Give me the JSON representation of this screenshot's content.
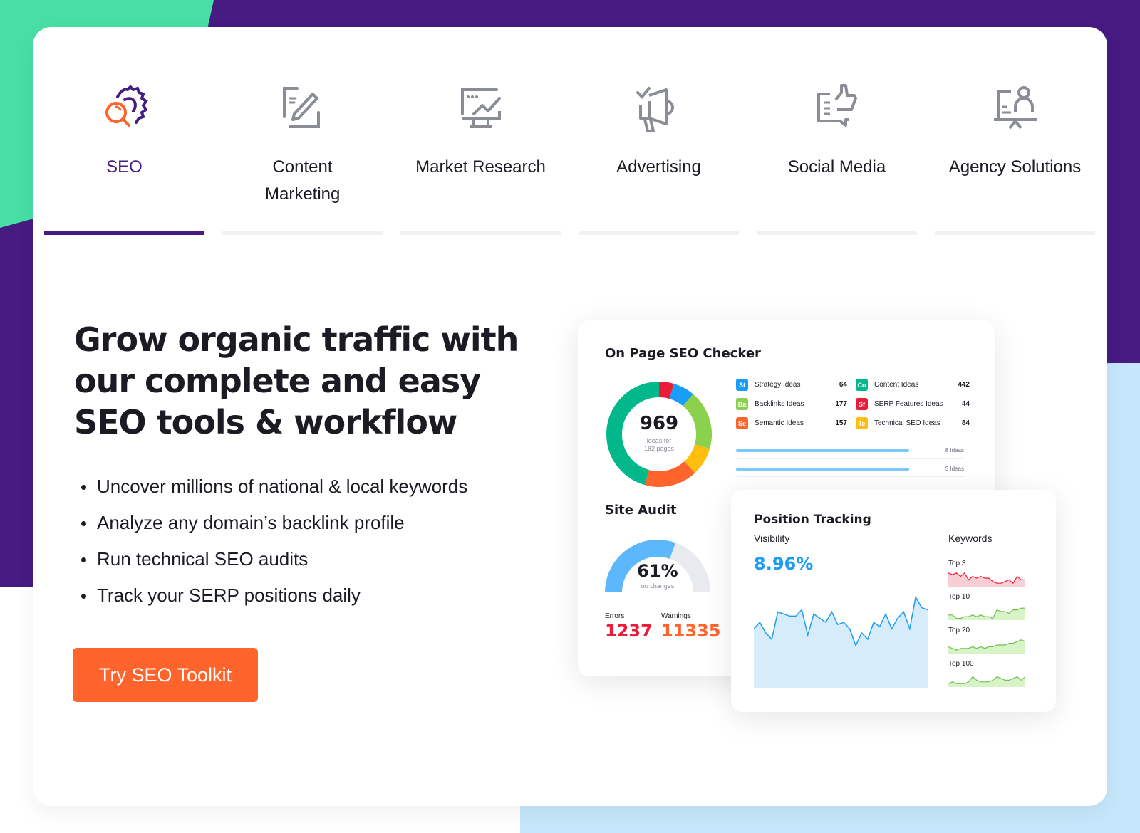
{
  "tabs": [
    {
      "label": "SEO",
      "icon": "seo-gear-search-icon",
      "active": true
    },
    {
      "label": "Content Marketing",
      "icon": "content-edit-icon",
      "active": false
    },
    {
      "label": "Market Research",
      "icon": "market-research-monitor-icon",
      "active": false
    },
    {
      "label": "Advertising",
      "icon": "megaphone-icon",
      "active": false
    },
    {
      "label": "Social Media",
      "icon": "thumbs-up-chat-icon",
      "active": false
    },
    {
      "label": "Agency Solutions",
      "icon": "presentation-person-icon",
      "active": false
    }
  ],
  "hero": {
    "title": "Grow organic traffic with our complete and easy SEO tools & workflow",
    "bullets": [
      "Uncover millions of national & local keywords",
      "Analyze any domain’s backlink profile",
      "Run technical SEO audits",
      "Track your SERP positions daily"
    ],
    "cta_label": "Try SEO Toolkit"
  },
  "colors": {
    "brand_purple": "#461b82",
    "brand_orange": "#ff642d",
    "accent_green": "#47dfa6",
    "accent_blue": "#1a9df5"
  },
  "on_page": {
    "title": "On Page SEO Checker",
    "total": "969",
    "total_sub_line1": "ideas for",
    "total_sub_line2": "182 pages",
    "ideas": [
      {
        "abbr": "St",
        "name": "Strategy Ideas",
        "count": 64,
        "color": "#1a9df5"
      },
      {
        "abbr": "Ba",
        "name": "Backlinks Ideas",
        "count": 177,
        "color": "#8bd14e"
      },
      {
        "abbr": "Se",
        "name": "Semantic Ideas",
        "count": 157,
        "color": "#ff642d"
      },
      {
        "abbr": "Co",
        "name": "Content Ideas",
        "count": 442,
        "color": "#00b88a"
      },
      {
        "abbr": "Sf",
        "name": "SERP Features Ideas",
        "count": 44,
        "color": "#ed1b3a"
      },
      {
        "abbr": "Te",
        "name": "Technical SEO Ideas",
        "count": 84,
        "color": "#ffbe0b"
      }
    ],
    "page_bars": [
      {
        "label": "8 Ideas",
        "fill": 0.76
      },
      {
        "label": "5 Ideas",
        "fill": 0.76
      }
    ]
  },
  "site_audit": {
    "title": "Site Audit",
    "percent": 61,
    "percent_label": "61%",
    "sub": "no changes",
    "errors_label": "Errors",
    "errors_value": "1237",
    "warnings_label": "Warnings",
    "warnings_value": "11335"
  },
  "position_tracking": {
    "title": "Position Tracking",
    "visibility_label": "Visibility",
    "visibility_value": "8.96%",
    "visibility_series": [
      56,
      62,
      52,
      46,
      72,
      70,
      68,
      68,
      74,
      50,
      70,
      66,
      62,
      72,
      60,
      62,
      56,
      40,
      52,
      46,
      62,
      58,
      70,
      56,
      66,
      72,
      56,
      86,
      76,
      74
    ],
    "keywords_label": "Keywords",
    "keywords": [
      {
        "label": "Top 3",
        "color": "#ed1b3a",
        "fill": "#f8cdd3",
        "series": [
          8,
          7,
          8,
          6,
          8,
          4,
          6,
          5,
          6,
          5,
          5,
          3,
          2,
          2,
          3,
          4,
          2,
          6,
          4,
          4
        ]
      },
      {
        "label": "Top 10",
        "color": "#6cc24a",
        "fill": "#d8f3c8",
        "series": [
          3,
          3,
          1,
          1,
          2,
          2,
          3,
          2,
          3,
          2,
          2,
          1,
          6,
          5,
          5,
          4,
          6,
          6,
          7,
          7
        ]
      },
      {
        "label": "Top 20",
        "color": "#6cc24a",
        "fill": "#d8f3c8",
        "series": [
          4,
          3,
          2,
          3,
          3,
          3,
          4,
          3,
          4,
          3,
          4,
          4,
          5,
          5,
          5,
          6,
          6,
          7,
          8,
          7
        ]
      },
      {
        "label": "Top 100",
        "color": "#6cc24a",
        "fill": "#d8f3c8",
        "series": [
          2,
          3,
          2,
          2,
          2,
          3,
          6,
          4,
          3,
          3,
          3,
          4,
          6,
          5,
          4,
          4,
          5,
          6,
          4,
          6
        ]
      }
    ]
  }
}
